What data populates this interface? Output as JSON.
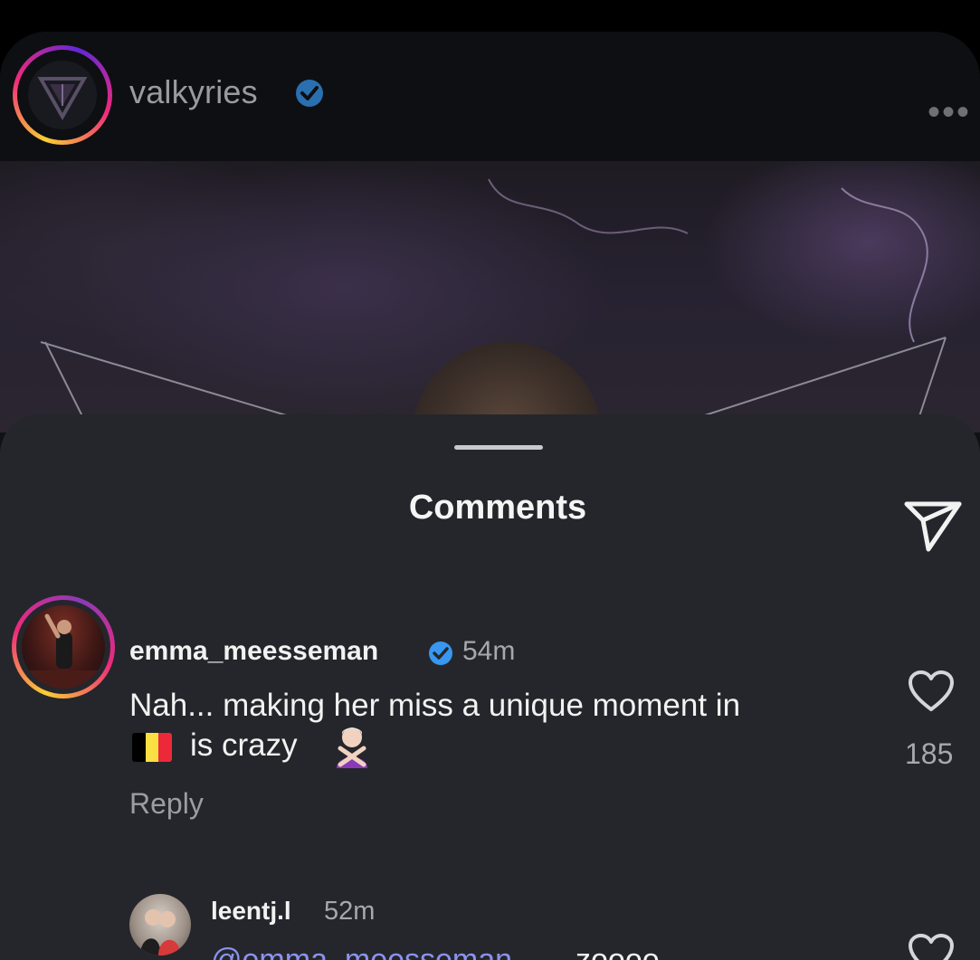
{
  "post": {
    "username": "valkyries",
    "more_label": "•••"
  },
  "sheet": {
    "title": "Comments"
  },
  "comment": {
    "username": "emma_meesseman",
    "time": "54m",
    "text_line1": "Nah... making her miss a unique moment in",
    "text_line2": "is crazy",
    "reply_label": "Reply",
    "like_count": "185"
  },
  "reply": {
    "username": "leentj.l",
    "time": "52m",
    "mention": "@emma_meesseman",
    "text": "zoooo"
  },
  "colors": {
    "verified": "#3897f0",
    "mention": "#8a93f0",
    "sheet_bg": "#25262b"
  }
}
